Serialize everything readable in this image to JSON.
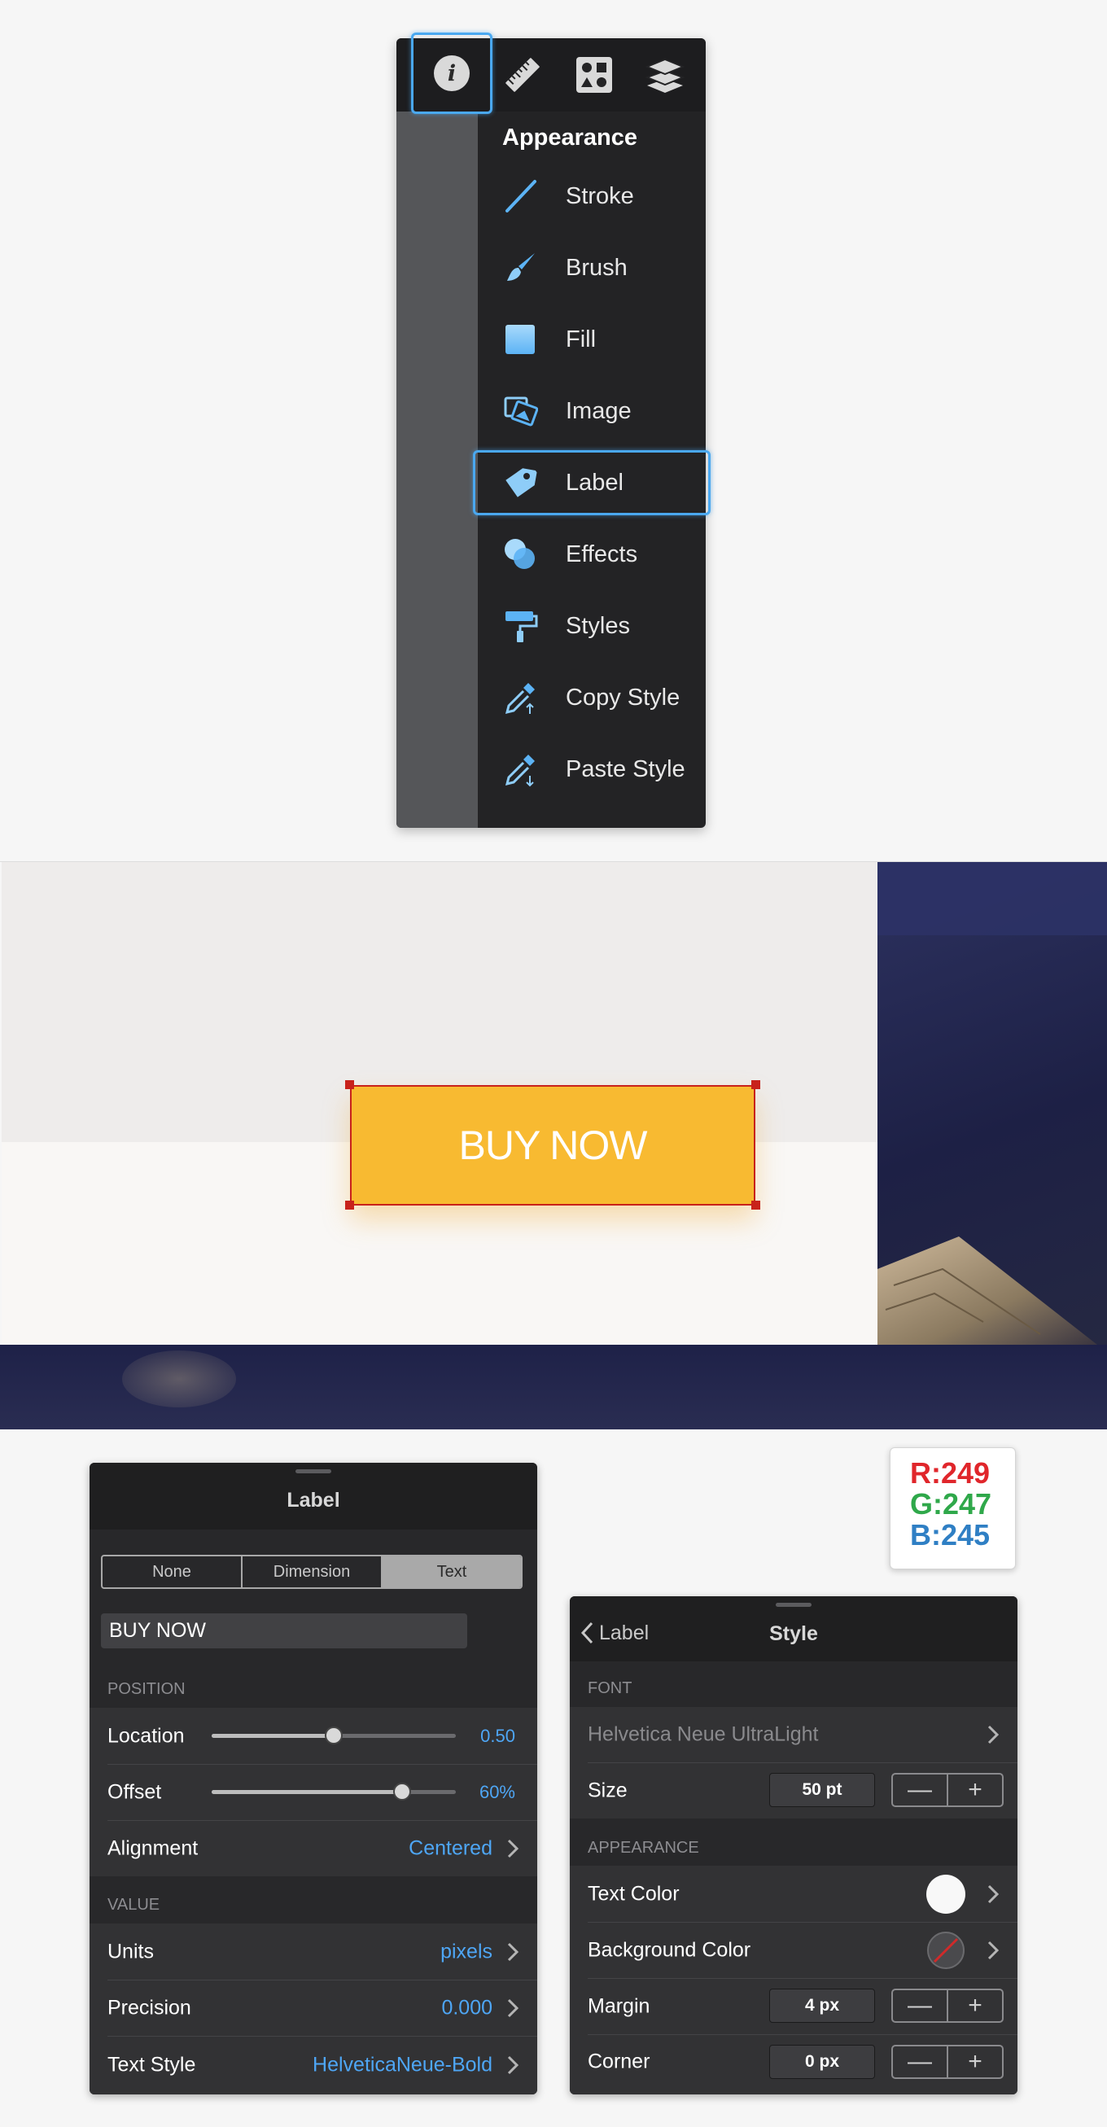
{
  "menu": {
    "tabs": [
      {
        "name": "info-icon"
      },
      {
        "name": "ruler-icon"
      },
      {
        "name": "shapes-icon"
      },
      {
        "name": "layers-icon"
      }
    ],
    "heading": "Appearance",
    "items": [
      {
        "label": "Stroke",
        "icon": "stroke-icon"
      },
      {
        "label": "Brush",
        "icon": "brush-icon"
      },
      {
        "label": "Fill",
        "icon": "fill-icon"
      },
      {
        "label": "Image",
        "icon": "image-icon"
      },
      {
        "label": "Label",
        "icon": "label-icon"
      },
      {
        "label": "Effects",
        "icon": "effects-icon"
      },
      {
        "label": "Styles",
        "icon": "paint-roller-icon"
      },
      {
        "label": "Copy Style",
        "icon": "eyedropper-up-icon"
      },
      {
        "label": "Paste Style",
        "icon": "eyedropper-down-icon"
      }
    ],
    "accent": "#4aa8f0"
  },
  "canvas": {
    "button_text": "BUY NOW",
    "button_color": "#f8ba31",
    "selection_color": "#c8221b"
  },
  "label_panel": {
    "title": "Label",
    "segments": [
      "None",
      "Dimension",
      "Text"
    ],
    "active_segment": "Text",
    "text_value": "BUY NOW",
    "position_section": "POSITION",
    "location": {
      "label": "Location",
      "value": "0.50",
      "fraction": 0.5
    },
    "offset": {
      "label": "Offset",
      "value": "60%",
      "fraction": 0.78
    },
    "alignment": {
      "label": "Alignment",
      "value": "Centered"
    },
    "value_section": "VALUE",
    "units": {
      "label": "Units",
      "value": "pixels"
    },
    "precision": {
      "label": "Precision",
      "value": "0.000"
    },
    "text_style": {
      "label": "Text Style",
      "value": "HelveticaNeue-Bold"
    }
  },
  "style_panel": {
    "back_label": "Label",
    "title": "Style",
    "font_section": "FONT",
    "font_name": "Helvetica Neue UltraLight",
    "size": {
      "label": "Size",
      "value": "50 pt"
    },
    "appearance_section": "APPEARANCE",
    "text_color": {
      "label": "Text Color",
      "swatch": "#f8f8f8"
    },
    "background_color": {
      "label": "Background Color"
    },
    "margin": {
      "label": "Margin",
      "value": "4 px"
    },
    "corner": {
      "label": "Corner",
      "value": "0 px"
    },
    "stepper_minus": "—",
    "stepper_plus": "+"
  },
  "rgb_badge": {
    "r": "R:249",
    "g": "G:247",
    "b": "B:245",
    "r_color": "#e0262b",
    "g_color": "#2fa84a",
    "b_color": "#2f7fc4"
  }
}
